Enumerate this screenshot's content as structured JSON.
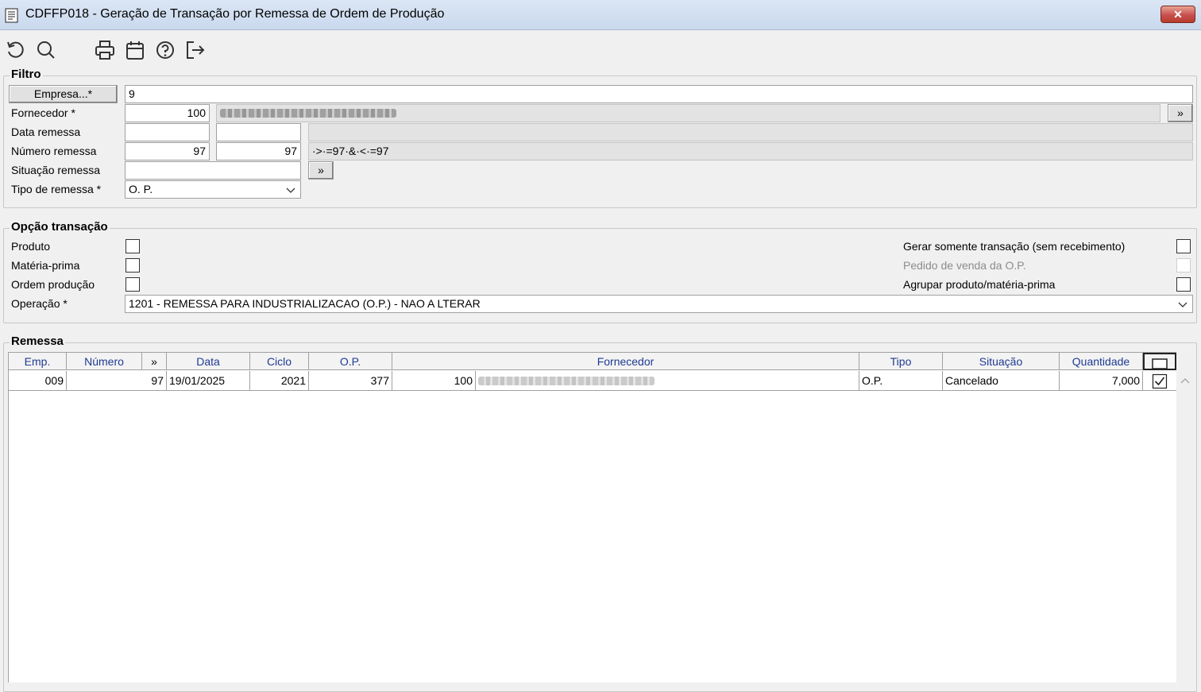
{
  "window": {
    "title": "CDFFP018 - Geração de Transação por Remessa de Ordem de Produção",
    "close_label": "✕"
  },
  "toolbar": {
    "icons": [
      "refresh-icon",
      "search-icon",
      "print-icon",
      "calendar-icon",
      "help-icon",
      "exit-icon"
    ]
  },
  "filtro": {
    "title": "Filtro",
    "empresa_button": "Empresa...*",
    "empresa_value": "9",
    "fornecedor_label": "Fornecedor *",
    "fornecedor_code": "100",
    "fornecedor_more": "»",
    "data_remessa_label": "Data remessa",
    "data_remessa_from": "",
    "data_remessa_to": "",
    "numero_remessa_label": "Número remessa",
    "numero_remessa_from": "97",
    "numero_remessa_to": "97",
    "numero_remessa_expr": "·>·=97·&·<·=97",
    "situacao_label": "Situação remessa",
    "situacao_value": "",
    "situacao_more": "»",
    "tipo_label": "Tipo de remessa *",
    "tipo_value": "O. P."
  },
  "opcao": {
    "title": "Opção transação",
    "produto_label": "Produto",
    "materia_prima_label": "Matéria-prima",
    "ordem_producao_label": "Ordem produção",
    "operacao_label": "Operação *",
    "operacao_value": "1201 - REMESSA PARA INDUSTRIALIZACAO (O.P.) - NAO A LTERAR",
    "gerar_label": "Gerar somente transação (sem recebimento)",
    "pedido_label": "Pedido de venda da O.P.",
    "agrupar_label": "Agrupar produto/matéria-prima",
    "checks": {
      "produto": false,
      "materia_prima": false,
      "ordem_producao": false,
      "gerar": false,
      "pedido": false,
      "agrupar": false
    }
  },
  "remessa": {
    "title": "Remessa",
    "columns": [
      "Emp.",
      "Número",
      "»",
      "Data",
      "Ciclo",
      "O.P.",
      "Fornecedor",
      "Tipo",
      "Situação",
      "Quantidade"
    ],
    "rows": [
      {
        "emp": "009",
        "numero": "97",
        "data": "19/01/2025",
        "ciclo": "2021",
        "op": "377",
        "fornecedor_code": "100",
        "tipo": "O.P.",
        "situacao": "Cancelado",
        "quantidade": "7,000",
        "checked": true
      }
    ]
  }
}
